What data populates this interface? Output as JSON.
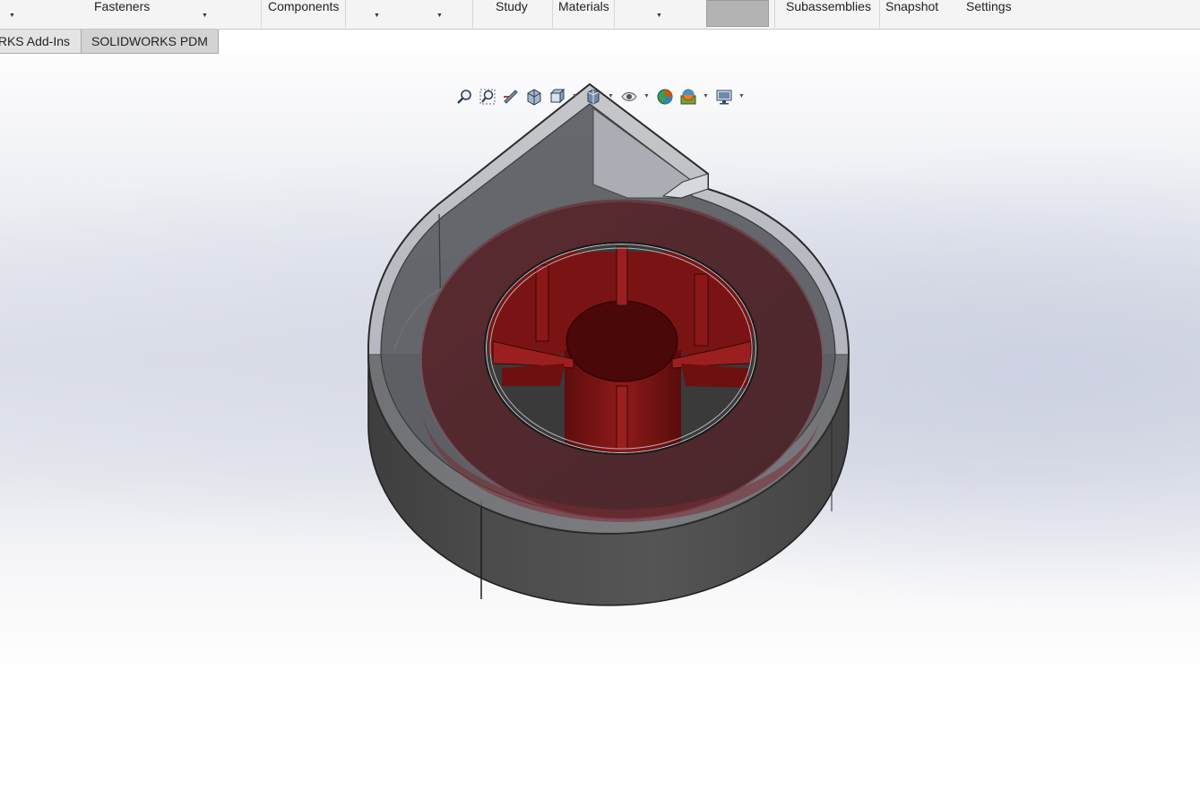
{
  "ribbon": {
    "items": [
      {
        "label": "Fasteners"
      },
      {
        "label": "Components"
      },
      {
        "label": "Study"
      },
      {
        "label": "Materials"
      },
      {
        "label": "Subassemblies"
      },
      {
        "label": "Snapshot"
      },
      {
        "label": "Settings"
      }
    ]
  },
  "tabs": [
    {
      "label": "RKS Add-Ins"
    },
    {
      "label": "SOLIDWORKS PDM"
    }
  ],
  "view_toolbar": {
    "icons": [
      "zoom-to-fit-icon",
      "zoom-to-area-icon",
      "previous-view-icon",
      "section-view-icon",
      "view-orientation-icon",
      "display-style-icon",
      "hide-show-items-icon",
      "edit-appearance-icon",
      "apply-scene-icon",
      "view-settings-icon"
    ]
  },
  "colors": {
    "ribbon_bg": "#f4f4f4",
    "tab_bg": "#e4e4e4",
    "housing_dark": "#4a4a4a",
    "impeller_red": "#7a1515",
    "shroud_ring": "#4c2a2e"
  }
}
